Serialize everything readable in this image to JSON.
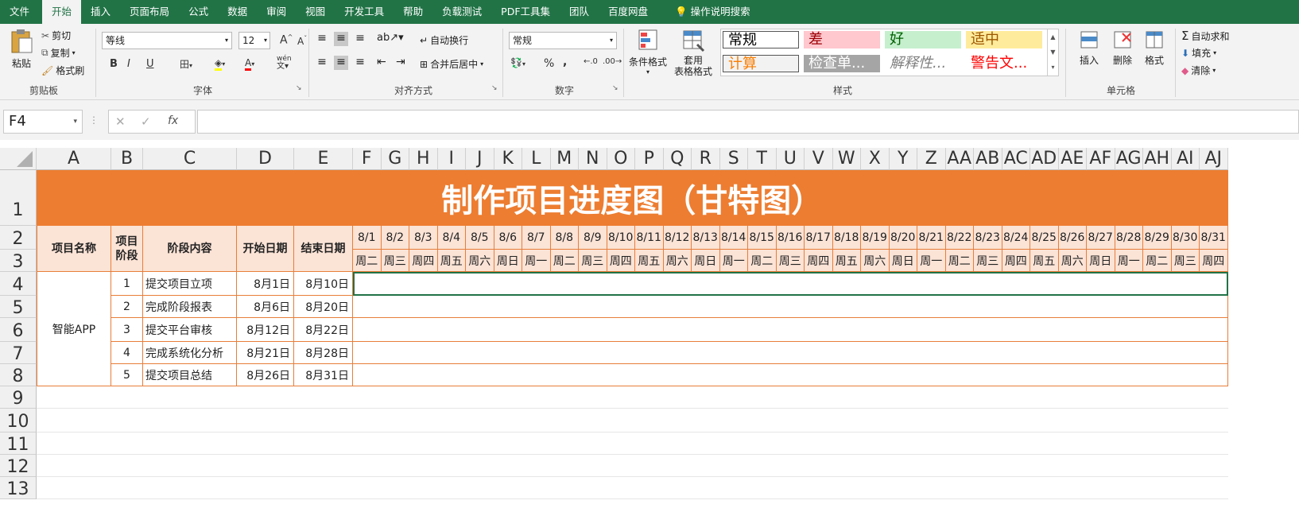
{
  "menu": [
    "文件",
    "开始",
    "插入",
    "页面布局",
    "公式",
    "数据",
    "审阅",
    "视图",
    "开发工具",
    "帮助",
    "负载测试",
    "PDF工具集",
    "团队",
    "百度网盘",
    "操作说明搜索"
  ],
  "ribbon": {
    "clipboard": {
      "paste": "粘贴",
      "cut": "剪切",
      "copy": "复制",
      "format_painter": "格式刷",
      "label": "剪贴板"
    },
    "font": {
      "name": "等线",
      "size": "12",
      "label": "字体",
      "bold": "B",
      "italic": "I",
      "underline": "U",
      "grow": "A",
      "shrink": "A",
      "color": "A",
      "phonetic": "wén"
    },
    "align": {
      "wrap": "自动换行",
      "merge": "合并后居中",
      "label": "对齐方式"
    },
    "number": {
      "format": "常规",
      "label": "数字",
      "percent": "%",
      "comma": ","
    },
    "styles": {
      "cond": "条件格式",
      "table": "套用\n表格格式",
      "label": "样式",
      "items": [
        {
          "text": "常规",
          "bg": "#ffffff",
          "color": "#000000"
        },
        {
          "text": "差",
          "bg": "#ffc7ce",
          "color": "#9c0006"
        },
        {
          "text": "好",
          "bg": "#c6efce",
          "color": "#006100"
        },
        {
          "text": "适中",
          "bg": "#ffeb9c",
          "color": "#9c5700"
        },
        {
          "text": "计算",
          "bg": "#f2f2f2",
          "color": "#fa7d00"
        },
        {
          "text": "检查单...",
          "bg": "#a5a5a5",
          "color": "#ffffff"
        },
        {
          "text": "解释性...",
          "bg": "#ffffff",
          "color": "#7f7f7f"
        },
        {
          "text": "警告文...",
          "bg": "#ffffff",
          "color": "#ff0000"
        }
      ]
    },
    "cells": {
      "insert": "插入",
      "delete": "删除",
      "format": "格式",
      "label": "单元格"
    },
    "editing": {
      "autosum": "自动求和",
      "fill": "填充",
      "clear": "清除"
    }
  },
  "formula_bar": {
    "name_box": "F4",
    "formula": ""
  },
  "columns": [
    "A",
    "B",
    "C",
    "D",
    "E",
    "F",
    "G",
    "H",
    "I",
    "J",
    "K",
    "L",
    "M",
    "N",
    "O",
    "P",
    "Q",
    "R",
    "S",
    "T",
    "U",
    "V",
    "W",
    "X",
    "Y",
    "Z",
    "AA",
    "AB",
    "AC",
    "AD",
    "AE",
    "AF",
    "AG",
    "AH",
    "AI",
    "AJ"
  ],
  "rows": [
    "1",
    "2",
    "3",
    "4",
    "5",
    "6",
    "7",
    "8",
    "9",
    "10",
    "11",
    "12",
    "13"
  ],
  "sheet": {
    "title": "制作项目进度图（甘特图）",
    "headers": {
      "project": "项目名称",
      "stage": "项目\n阶段",
      "content": "阶段内容",
      "start": "开始日期",
      "end": "结束日期"
    },
    "dates": [
      "8/1",
      "8/2",
      "8/3",
      "8/4",
      "8/5",
      "8/6",
      "8/7",
      "8/8",
      "8/9",
      "8/10",
      "8/11",
      "8/12",
      "8/13",
      "8/14",
      "8/15",
      "8/16",
      "8/17",
      "8/18",
      "8/19",
      "8/20",
      "8/21",
      "8/22",
      "8/23",
      "8/24",
      "8/25",
      "8/26",
      "8/27",
      "8/28",
      "8/29",
      "8/30",
      "8/31"
    ],
    "weekdays": [
      "周二",
      "周三",
      "周四",
      "周五",
      "周六",
      "周日",
      "周一",
      "周二",
      "周三",
      "周四",
      "周五",
      "周六",
      "周日",
      "周一",
      "周二",
      "周三",
      "周四",
      "周五",
      "周六",
      "周日",
      "周一",
      "周二",
      "周三",
      "周四",
      "周五",
      "周六",
      "周日",
      "周一",
      "周二",
      "周三",
      "周四"
    ],
    "project_name": "智能APP",
    "tasks": [
      {
        "stage": "1",
        "content": "提交项目立项",
        "start": "8月1日",
        "end": "8月10日"
      },
      {
        "stage": "2",
        "content": "完成阶段报表",
        "start": "8月6日",
        "end": "8月20日"
      },
      {
        "stage": "3",
        "content": "提交平台审核",
        "start": "8月12日",
        "end": "8月22日"
      },
      {
        "stage": "4",
        "content": "完成系统化分析",
        "start": "8月21日",
        "end": "8月28日"
      },
      {
        "stage": "5",
        "content": "提交项目总结",
        "start": "8月26日",
        "end": "8月31日"
      }
    ]
  },
  "colors": {
    "accent": "#217346",
    "title_bg": "#ed7d31",
    "header_bg": "#fbe3d6",
    "border": "#e87e3a"
  }
}
